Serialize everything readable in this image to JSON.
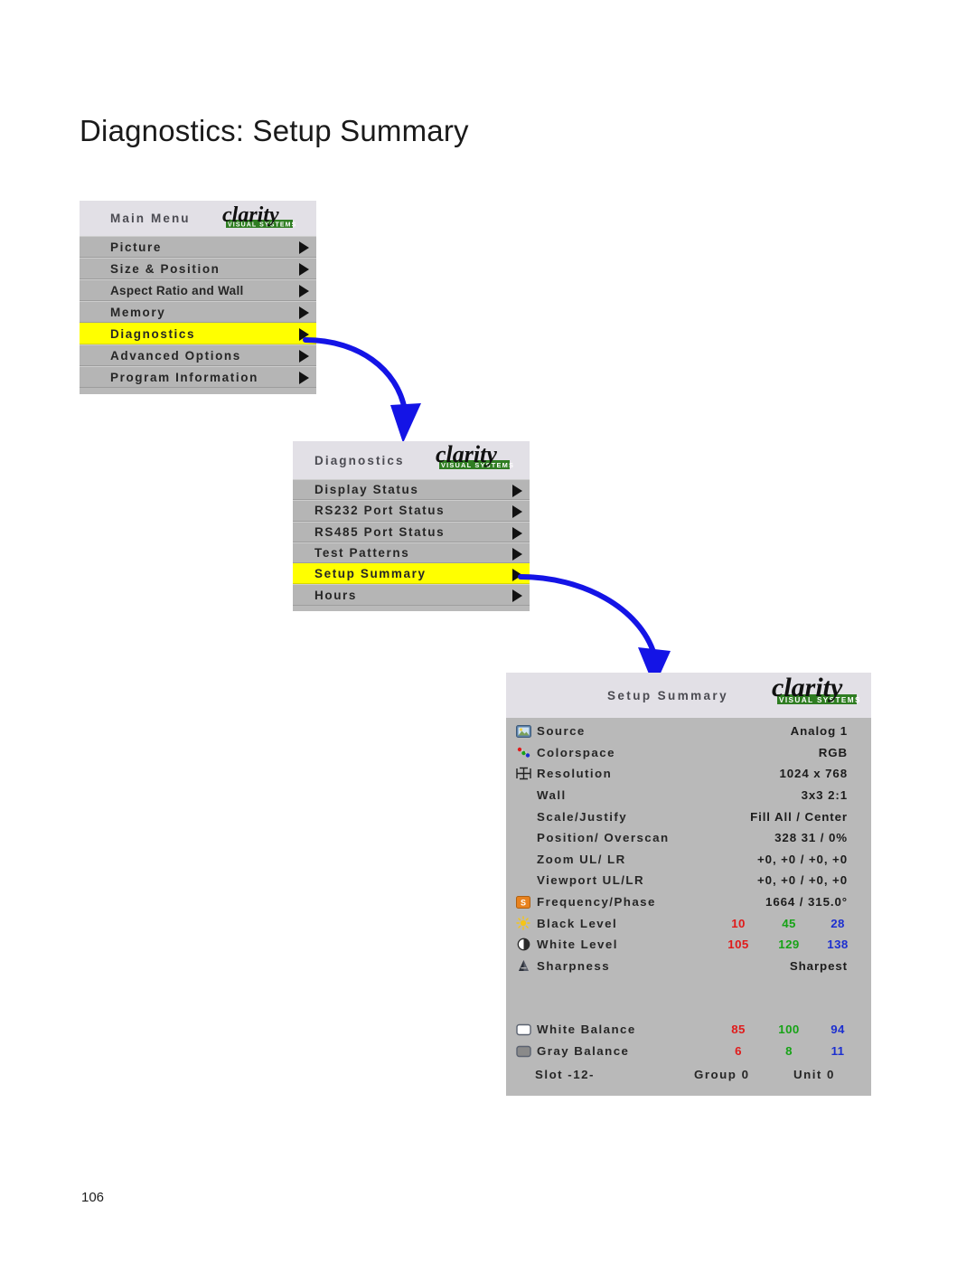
{
  "page": {
    "title": "Diagnostics: Setup Summary",
    "number": "106"
  },
  "logo": {
    "word": "clarity",
    "tagline": "VISUAL SYSTEMS"
  },
  "main_menu": {
    "title": "Main Menu",
    "items": [
      {
        "label": "Picture",
        "selected": false
      },
      {
        "label": "Size & Position",
        "selected": false
      },
      {
        "label": "Aspect Ratio and Wall",
        "selected": false
      },
      {
        "label": "Memory",
        "selected": false
      },
      {
        "label": "Diagnostics",
        "selected": true
      },
      {
        "label": "Advanced Options",
        "selected": false
      },
      {
        "label": "Program Information",
        "selected": false
      }
    ]
  },
  "diagnostics_menu": {
    "title": "Diagnostics",
    "items": [
      {
        "label": "Display Status",
        "selected": false
      },
      {
        "label": "RS232 Port Status",
        "selected": false
      },
      {
        "label": "RS485 Port Status",
        "selected": false
      },
      {
        "label": "Test Patterns",
        "selected": false
      },
      {
        "label": "Setup Summary",
        "selected": true
      },
      {
        "label": "Hours",
        "selected": false
      }
    ]
  },
  "setup_summary": {
    "title": "Setup Summary",
    "rows": [
      {
        "icon": "picture-icon",
        "label": "Source",
        "value": "Analog 1"
      },
      {
        "icon": "colorspace-icon",
        "label": "Colorspace",
        "value": "RGB"
      },
      {
        "icon": "resolution-icon",
        "label": "Resolution",
        "value": "1024 x 768"
      },
      {
        "icon": "none",
        "label": "Wall",
        "value": "3x3     2:1"
      },
      {
        "icon": "none",
        "label": "Scale/Justify",
        "value": "Fill All  /  Center"
      },
      {
        "icon": "none",
        "label": "Position/ Overscan",
        "value": "328  31   / 0%"
      },
      {
        "icon": "none",
        "label": "Zoom UL/ LR",
        "value": "+0, +0   /   +0, +0"
      },
      {
        "icon": "none",
        "label": "Viewport UL/LR",
        "value": "+0, +0   /   +0, +0"
      },
      {
        "icon": "frequency-icon",
        "label": "Frequency/Phase",
        "value": "1664 / 315.0°"
      }
    ],
    "rgb_rows": [
      {
        "icon": "brightness-icon",
        "label": "Black Level",
        "r": "10",
        "g": "45",
        "b": "28"
      },
      {
        "icon": "contrast-icon",
        "label": "White Level",
        "r": "105",
        "g": "129",
        "b": "138"
      }
    ],
    "sharpness": {
      "icon": "sharpness-icon",
      "label": "Sharpness",
      "value": "Sharpest"
    },
    "balance_rows": [
      {
        "icon": "white-balance-icon",
        "label": "White Balance",
        "r": "85",
        "g": "100",
        "b": "94"
      },
      {
        "icon": "gray-balance-icon",
        "label": "Gray Balance",
        "r": "6",
        "g": "8",
        "b": "11"
      }
    ],
    "footer": {
      "slot": "Slot  -12-",
      "group": "Group  0",
      "unit": "Unit  0"
    }
  },
  "colors": {
    "highlight": "#ffff00",
    "arrow": "#1414e6",
    "red": "#e01b1b",
    "green": "#17a317",
    "blue": "#1c2fd0",
    "panel": "#b5b5b5",
    "header": "#e2e0e6"
  }
}
